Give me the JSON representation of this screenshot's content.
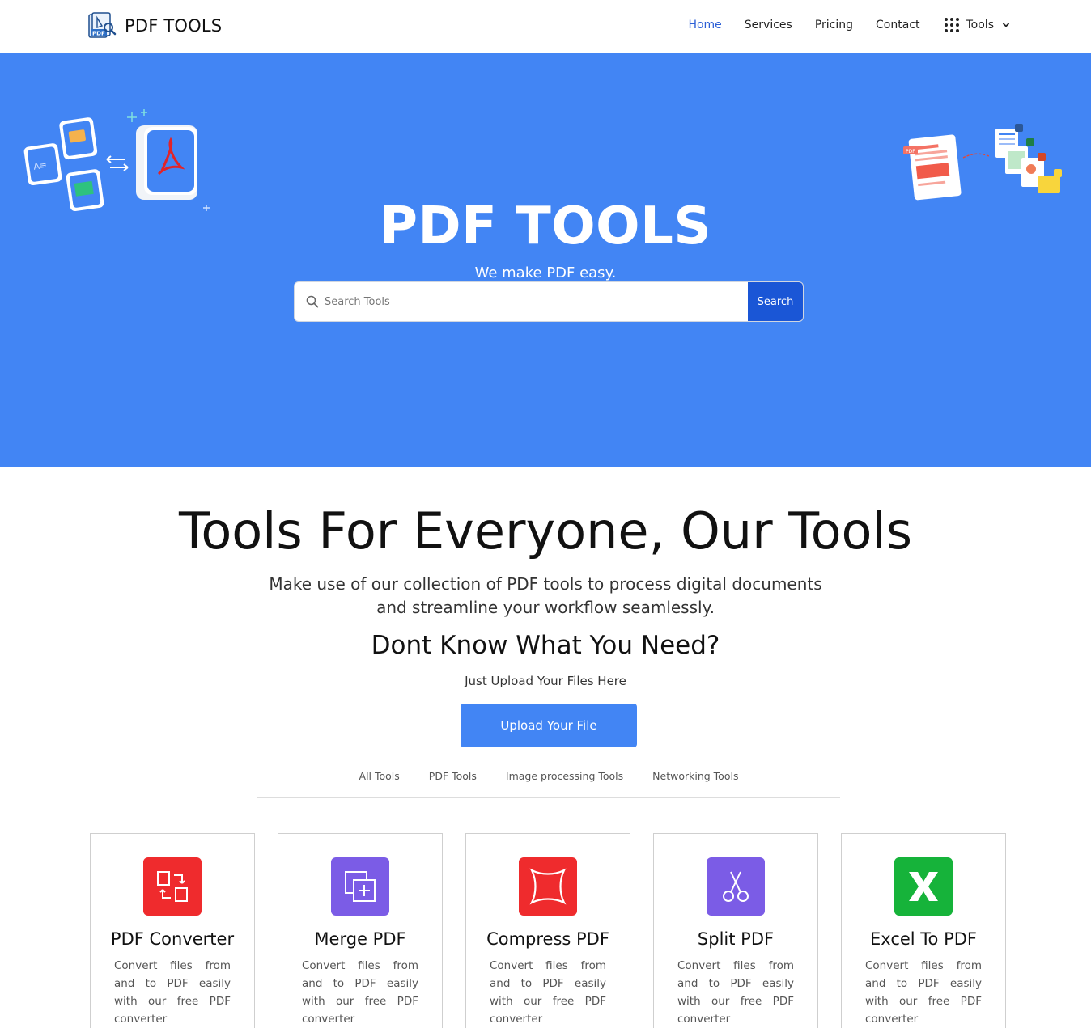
{
  "header": {
    "logo_text": "PDF TOOLS",
    "nav": [
      {
        "label": "Home",
        "active": true
      },
      {
        "label": "Services"
      },
      {
        "label": "Pricing"
      },
      {
        "label": "Contact"
      }
    ],
    "tools_menu_label": "Tools",
    "tools_menu_icon": "grid-icon"
  },
  "hero": {
    "title": "PDF TOOLS",
    "subtitle": "We make PDF easy.",
    "search_placeholder": "Search Tools",
    "search_button": "Search",
    "background_color": "#4285f4"
  },
  "section": {
    "title": "Tools For Everyone, Our Tools",
    "description": "Make use of our collection of PDF tools to process digital documents and streamline your workflow seamlessly.",
    "need_title": "Dont Know What You Need?",
    "need_subtitle": "Just Upload Your Files Here",
    "upload_button": "Upload Your File"
  },
  "tabs": [
    "All Tools",
    "PDF Tools",
    "Image processing Tools",
    "Networking Tools"
  ],
  "cards": [
    {
      "title": "PDF Converter",
      "desc": "Convert files from and to PDF easily with our free PDF converter",
      "icon": "convert-icon",
      "color": "#ef2b2d"
    },
    {
      "title": "Merge PDF",
      "desc": "Convert files from and to PDF easily with our free PDF converter",
      "icon": "merge-icon",
      "color": "#7b5ce6"
    },
    {
      "title": "Compress PDF",
      "desc": "Convert files from and to PDF easily with our free PDF converter",
      "icon": "compress-icon",
      "color": "#ef2b2d"
    },
    {
      "title": "Split PDF",
      "desc": "Convert files from and to PDF easily with our free PDF converter",
      "icon": "scissors-icon",
      "color": "#7b5ce6"
    },
    {
      "title": "Excel To PDF",
      "desc": "Convert files from and to PDF easily with our free PDF converter",
      "icon": "excel-icon",
      "color": "#16b33a"
    }
  ]
}
